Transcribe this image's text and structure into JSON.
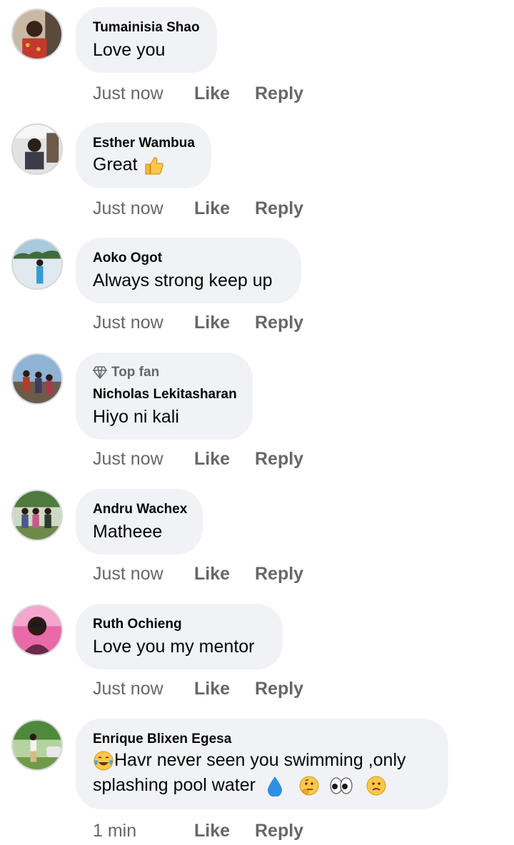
{
  "comments": [
    {
      "author": "Tumainisia Shao",
      "text": "Love you",
      "time": "Just now",
      "like": "Like",
      "reply": "Reply"
    },
    {
      "author": "Esther Wambua",
      "text": "Great",
      "emoji_icons": [
        "thumbs-up-icon"
      ],
      "time": "Just now",
      "like": "Like",
      "reply": "Reply"
    },
    {
      "author": "Aoko Ogot",
      "text": "Always strong keep up",
      "time": "Just now",
      "like": "Like",
      "reply": "Reply"
    },
    {
      "badge": "Top fan",
      "badge_icon": "diamond-icon",
      "author": "Nicholas Lekitasharan",
      "text": "Hiyo ni kali",
      "time": "Just now",
      "like": "Like",
      "reply": "Reply"
    },
    {
      "author": "Andru Wachex",
      "text": "Matheee",
      "time": "Just now",
      "like": "Like",
      "reply": "Reply"
    },
    {
      "author": "Ruth Ochieng",
      "text": "Love you my mentor",
      "time": "Just now",
      "like": "Like",
      "reply": "Reply"
    },
    {
      "author": "Enrique Blixen Egesa",
      "text_line1": "Havr never seen you swimming ,only",
      "text_line2": "splashing pool water",
      "emoji_icons": [
        "tears-of-joy-icon",
        "droplet-icon",
        "thinking-face-icon",
        "eyes-icon",
        "confused-face-icon"
      ],
      "time": "1 min",
      "like": "Like",
      "reply": "Reply"
    }
  ],
  "colors": {
    "bubble": "#f0f2f5",
    "text": "#050505",
    "secondary": "#65676b",
    "avatar_border": "#d5d7db"
  }
}
